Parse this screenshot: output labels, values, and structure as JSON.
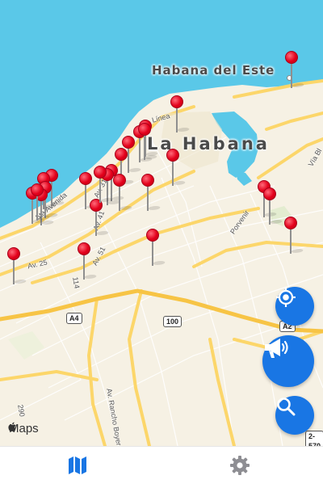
{
  "map": {
    "city_labels": [
      {
        "text": "Habana del Este",
        "name": "label-habana-del-este"
      },
      {
        "text": "La Habana",
        "name": "label-la-habana"
      }
    ],
    "street_labels": [
      {
        "text": "Línea",
        "name": "street-linea"
      },
      {
        "text": "5ta Avenida",
        "name": "street-5ta-avenida"
      },
      {
        "text": "Av. 31",
        "name": "street-av-31"
      },
      {
        "text": "Av. 41",
        "name": "street-av-41"
      },
      {
        "text": "Av. 25",
        "name": "street-av-25"
      },
      {
        "text": "Av. 51",
        "name": "street-av-51"
      },
      {
        "text": "Porvenir",
        "name": "street-porvenir"
      },
      {
        "text": "Vía Bl",
        "name": "street-via-blanca"
      },
      {
        "text": "Av. Rancho Boyeros",
        "name": "street-rancho-boyeros"
      },
      {
        "text": "114",
        "name": "street-114"
      },
      {
        "text": "290",
        "name": "street-290"
      }
    ],
    "shields": [
      {
        "text": "A4",
        "name": "shield-a4"
      },
      {
        "text": "100",
        "name": "shield-100"
      },
      {
        "text": "A2",
        "name": "shield-a2"
      },
      {
        "text": "2-570",
        "name": "shield-2-570"
      }
    ],
    "attribution": "Maps",
    "pin_count": 27
  },
  "buttons": {
    "locate_icon": "location-crosshair-icon",
    "announce_icon": "megaphone-icon",
    "search_icon": "search-icon"
  },
  "tabbar": {
    "tabs": [
      {
        "icon": "map-icon",
        "active": true
      },
      {
        "icon": "gear-icon",
        "active": false
      }
    ]
  },
  "colors": {
    "water": "#5ac8e8",
    "land": "#f6f1e4",
    "road": "#fcd66a",
    "pin": "#e3001b",
    "accent": "#1976e4",
    "tab_active": "#1976e4",
    "tab_inactive": "#8e8e93"
  }
}
